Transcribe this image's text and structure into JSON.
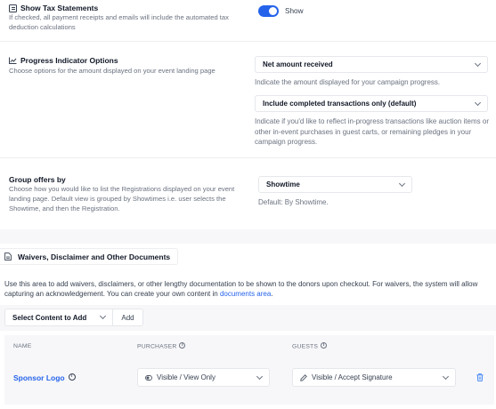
{
  "tax": {
    "title": "Show Tax Statements",
    "description": "If checked, all payment receipts and emails will include the automated tax deduction calculations",
    "toggle_label": "Show",
    "toggle_on": true
  },
  "progress": {
    "title": "Progress Indicator Options",
    "description": "Choose options for the amount displayed on your event landing page",
    "amount_select": "Net amount received",
    "amount_help": "Indicate the amount displayed for your campaign progress.",
    "transactions_select": "Include completed transactions only (default)",
    "transactions_help": "Indicate if you'd like to reflect in-progress transactions like auction items or other in-event purchases in guest carts, or remaining pledges in your campaign progress."
  },
  "group": {
    "title": "Group offers by",
    "description": "Choose how you would like to list the Registrations displayed on your event landing page. Default view is grouped by Showtimes i.e. user selects the Showtime, and then the Registration.",
    "select": "Showtime",
    "default_text": "Default: By Showtime."
  },
  "waivers": {
    "title": "Waivers, Disclaimer and Other Documents",
    "description": "Use this area to add waivers, disclaimers, or other lengthy documentation to be shown to the donors upon checkout. For waivers, the system will allow capturing an acknowledgement. You can create your own content in",
    "link_text": "documents area",
    "link_suffix": ".",
    "select_content": "Select Content to Add",
    "add_label": "Add",
    "columns": {
      "name": "NAME",
      "purchaser": "PURCHASER",
      "guests": "GUESTS"
    },
    "row": {
      "name": "Sponsor Logo",
      "purchaser": "Visible / View Only",
      "guests": "Visible / Accept Signature"
    }
  },
  "colors": {
    "accent": "#2563eb",
    "panel": "#f7f7f9",
    "delete": "#3b82f6"
  }
}
